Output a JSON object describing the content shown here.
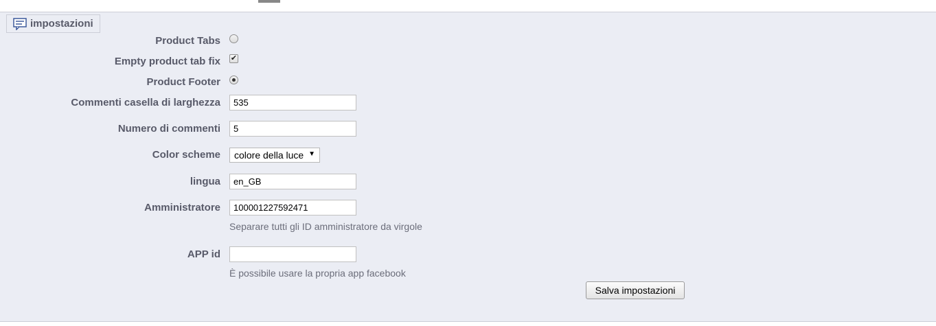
{
  "fieldset": {
    "title": "impostazioni",
    "icon": "comment-icon"
  },
  "fields": {
    "product_tabs": {
      "label": "Product Tabs",
      "checked": false
    },
    "empty_tab_fix": {
      "label": "Empty product tab fix",
      "checked": true,
      "mark": "✔"
    },
    "product_footer": {
      "label": "Product Footer",
      "checked": true
    },
    "comments_width": {
      "label": "Commenti casella di larghezza",
      "value": "535"
    },
    "comments_count": {
      "label": "Numero di commenti",
      "value": "5"
    },
    "color_scheme": {
      "label": "Color scheme",
      "selected": "colore della luce"
    },
    "language": {
      "label": "lingua",
      "value": "en_GB"
    },
    "admin": {
      "label": "Amministratore",
      "value": "100001227592471",
      "hint": "Separare tutti gli ID amministratore da virgole"
    },
    "app_id": {
      "label": "APP id",
      "value": "",
      "hint": "È possibile usare la propria app facebook"
    }
  },
  "save_button": "Salva impostazioni",
  "colors": {
    "panel_bg": "#ebedf4",
    "label_text": "#585a69",
    "border": "#ccced7"
  }
}
